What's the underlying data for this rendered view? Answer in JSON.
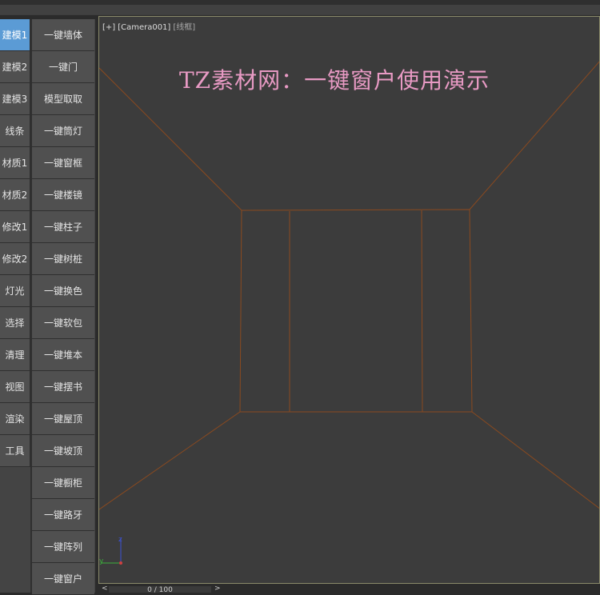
{
  "left_tabs": [
    "建模1",
    "建模2",
    "建模3",
    "线条",
    "材质1",
    "材质2",
    "修改1",
    "修改2",
    "灯光",
    "选择",
    "清理",
    "视图",
    "渲染",
    "工具"
  ],
  "active_tab": "建模1",
  "right_buttons": [
    "一键墙体",
    "一键门",
    "模型取取",
    "一键筒灯",
    "一键窗框",
    "一键楼镜",
    "一键柱子",
    "一键树桩",
    "一键换色",
    "一键软包",
    "一键堆本",
    "一键摆书",
    "一键屋顶",
    "一键坡顶",
    "一键橱柜",
    "一键路牙",
    "一键阵列",
    "一键窗户"
  ],
  "viewport": {
    "label_plus": "[+]",
    "label_camera": "[Camera001]",
    "label_mode": "[线框]",
    "title": "TZ素材网：一键窗户使用演示",
    "axis_z": "z",
    "axis_y": "y"
  },
  "timeline": {
    "frame": "0 / 100",
    "prev": "<",
    "next": ">"
  },
  "colors": {
    "active_tab": "#5b9bd5",
    "wireframe": "#8b4a1f",
    "title": "#e89ac4"
  }
}
